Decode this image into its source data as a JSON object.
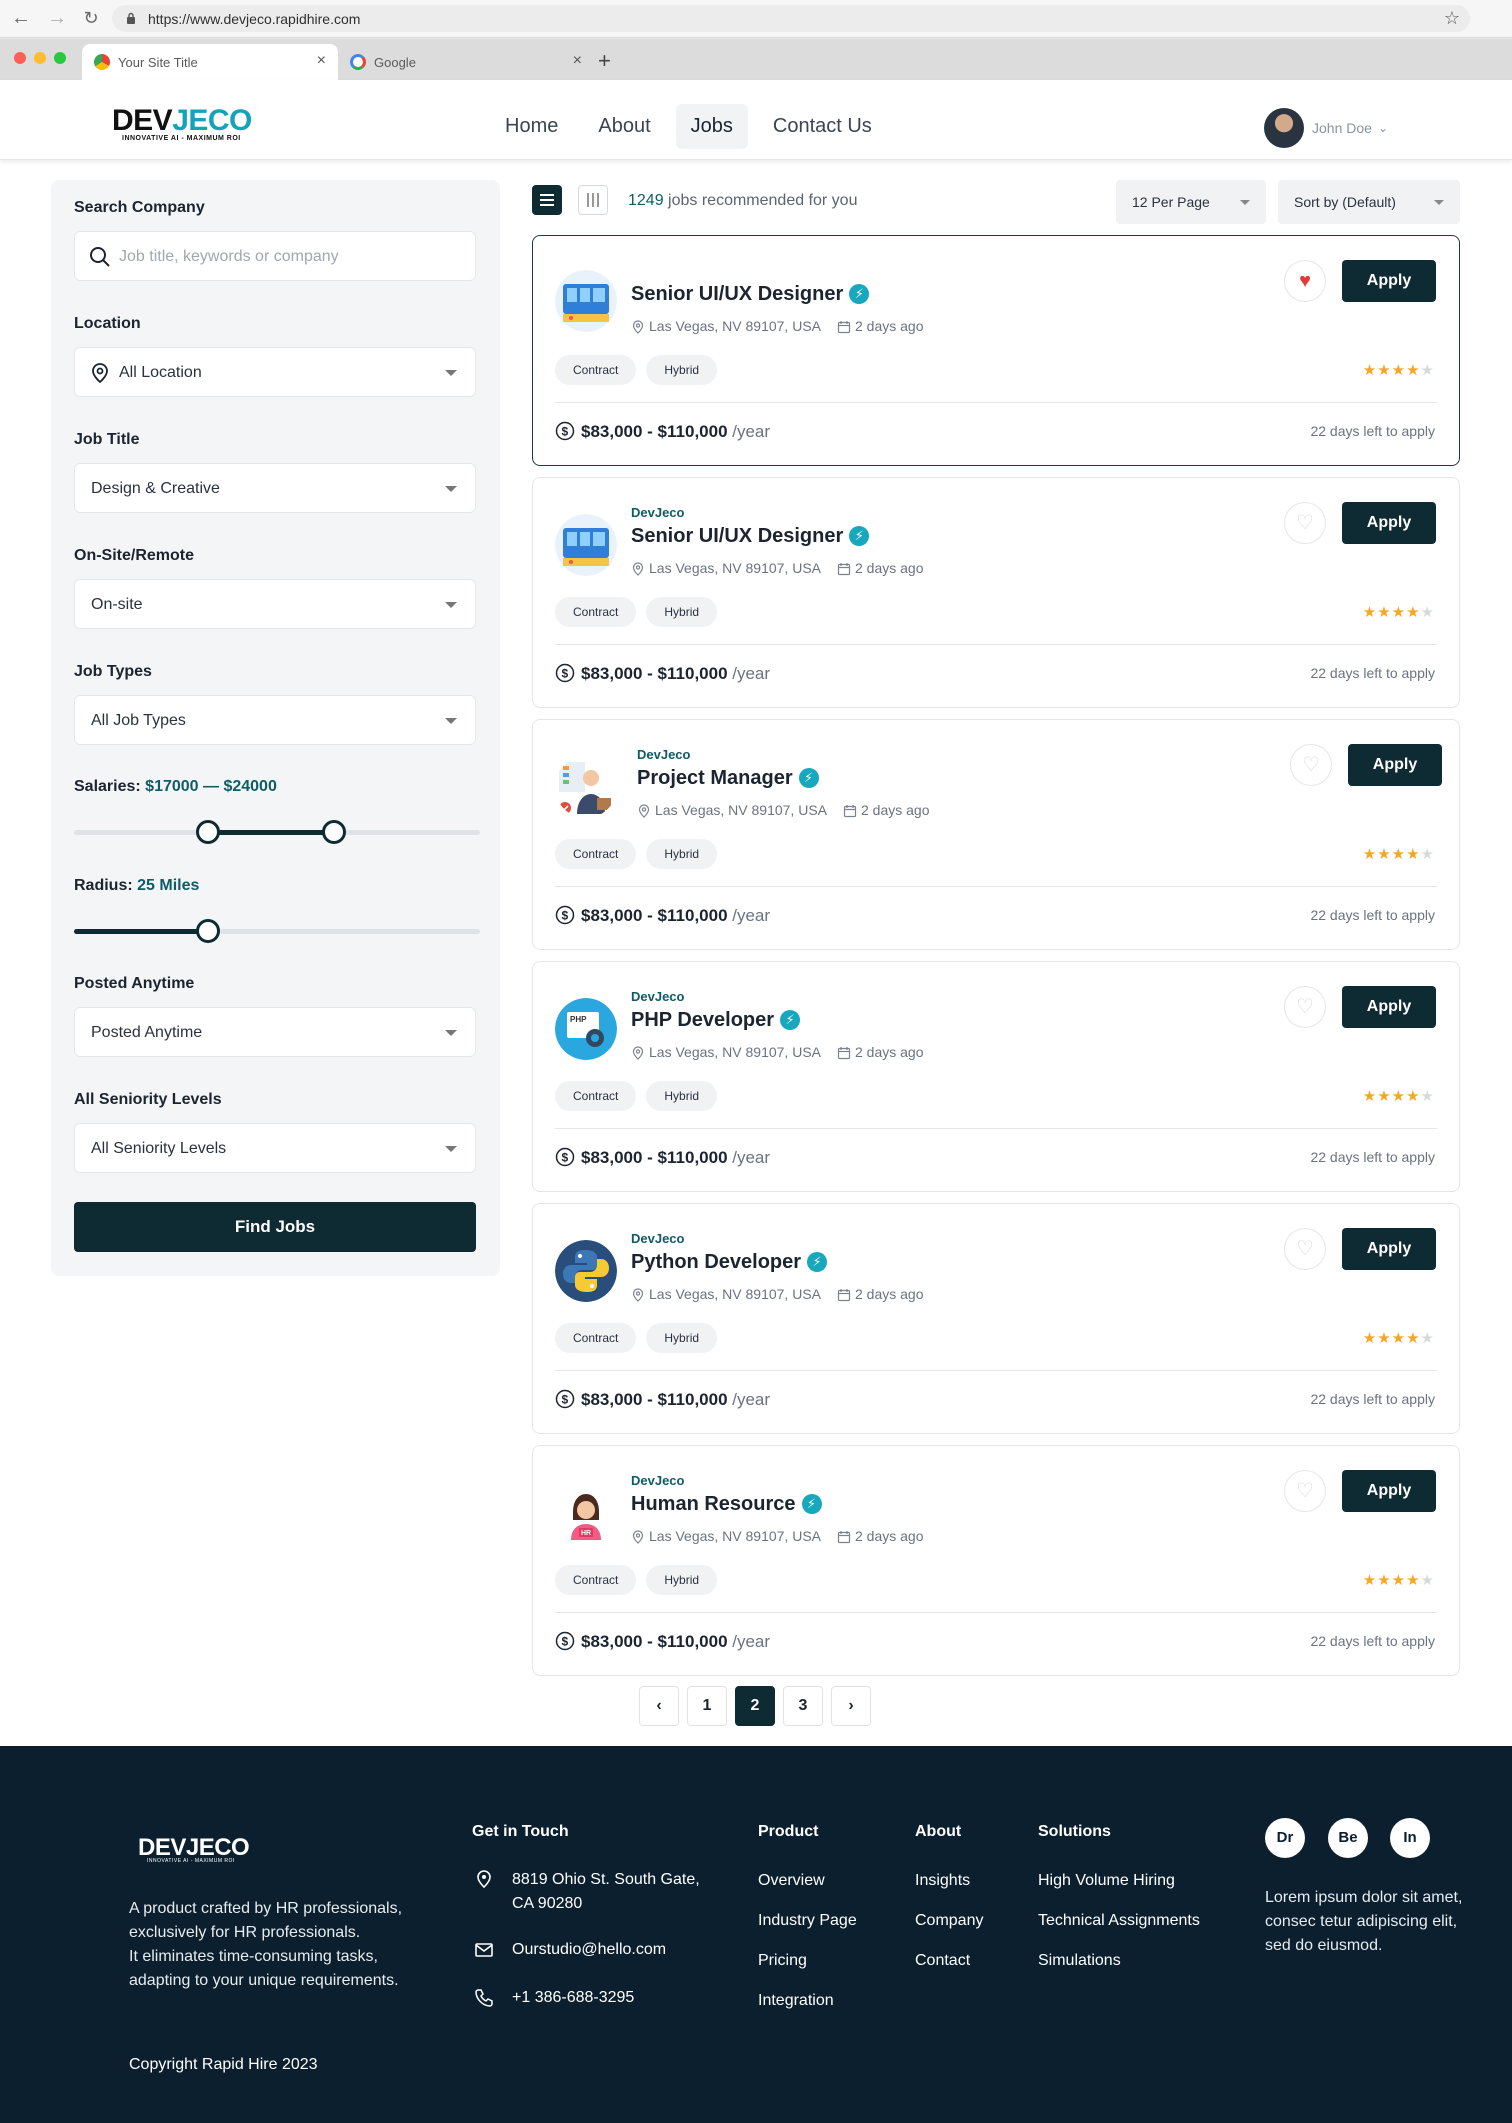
{
  "browser": {
    "url": "https://www.devjeco.rapidhire.com",
    "tabs": [
      {
        "title": "Your Site Title",
        "active": true
      },
      {
        "title": "Google",
        "active": false
      }
    ],
    "traffic_colors": [
      "#fe5f57",
      "#febc2e",
      "#28c840"
    ]
  },
  "header": {
    "logo_main_a": "DEV",
    "logo_main_b": "JECO",
    "logo_tagline": "INNOVATIVE AI - MAXIMUM ROI",
    "nav": [
      "Home",
      "About",
      "Jobs",
      "Contact Us"
    ],
    "nav_active": "Jobs",
    "user_name": "John Doe"
  },
  "sidebar": {
    "search_label": "Search Company",
    "search_placeholder": "Job title, keywords or company",
    "location_label": "Location",
    "location_value": "All Location",
    "job_title_label": "Job Title",
    "job_title_value": "Design & Creative",
    "onsite_label": "On-Site/Remote",
    "onsite_value": "On-site",
    "job_types_label": "Job Types",
    "job_types_value": "All Job Types",
    "salary_label": "Salaries:",
    "salary_range": "$17000 — $24000",
    "salary_slider": {
      "low": 0.33,
      "high": 0.64
    },
    "radius_label": "Radius:",
    "radius_value": "25 Miles",
    "radius_slider": 0.33,
    "posted_label": "Posted Anytime",
    "posted_value": "Posted Anytime",
    "seniority_label": "All Seniority Levels",
    "seniority_value": "All Seniority Levels",
    "find_button": "Find Jobs"
  },
  "results": {
    "count": "1249",
    "count_suffix": " jobs recommended for you",
    "per_page": "12 Per Page",
    "sort": "Sort by (Default)"
  },
  "jobs": [
    {
      "company": "",
      "title": "Senior UI/UX Designer",
      "location": "Las Vegas, NV 89107, USA",
      "posted": "2 days ago",
      "tags": [
        "Contract",
        "Hybrid"
      ],
      "rating": 4,
      "salary": "$83,000 - $110,000",
      "per": " /year",
      "deadline": "22 days left to apply",
      "favorited": true,
      "logo": "designer"
    },
    {
      "company": "DevJeco",
      "title": "Senior UI/UX Designer",
      "location": "Las Vegas, NV 89107, USA",
      "posted": "2 days ago",
      "tags": [
        "Contract",
        "Hybrid"
      ],
      "rating": 4,
      "salary": "$83,000 - $110,000",
      "per": " /year",
      "deadline": "22 days left to apply",
      "favorited": false,
      "logo": "designer"
    },
    {
      "company": "DevJeco",
      "title": "Project Manager",
      "location": "Las Vegas, NV 89107, USA",
      "posted": "2 days ago",
      "tags": [
        "Contract",
        "Hybrid"
      ],
      "rating": 4,
      "salary": "$83,000 - $110,000",
      "per": " /year",
      "deadline": "22 days left to apply",
      "favorited": false,
      "logo": "manager"
    },
    {
      "company": "DevJeco",
      "title": "PHP Developer",
      "location": "Las Vegas, NV 89107, USA",
      "posted": "2 days ago",
      "tags": [
        "Contract",
        "Hybrid"
      ],
      "rating": 4,
      "salary": "$83,000 - $110,000",
      "per": " /year",
      "deadline": "22 days left to apply",
      "favorited": false,
      "logo": "php"
    },
    {
      "company": "DevJeco",
      "title": "Python Developer",
      "location": "Las Vegas, NV 89107, USA",
      "posted": "2 days ago",
      "tags": [
        "Contract",
        "Hybrid"
      ],
      "rating": 4,
      "salary": "$83,000 - $110,000",
      "per": " /year",
      "deadline": "22 days left to apply",
      "favorited": false,
      "logo": "python"
    },
    {
      "company": "DevJeco",
      "title": "Human Resource",
      "location": "Las Vegas, NV 89107, USA",
      "posted": "2 days ago",
      "tags": [
        "Contract",
        "Hybrid"
      ],
      "rating": 4,
      "salary": "$83,000 - $110,000",
      "per": " /year",
      "deadline": "22 days left to apply",
      "favorited": false,
      "logo": "hr"
    }
  ],
  "pagination": {
    "pages": [
      "1",
      "2",
      "3"
    ],
    "current": "2"
  },
  "footer": {
    "logo": "DEVJECO",
    "logo_tagline": "INNOVATIVE AI - MAXIMUM ROI",
    "about_1": "A product crafted by HR professionals, exclusively for HR professionals.",
    "about_2": "It eliminates time-consuming tasks, adapting to your unique requirements.",
    "contact_head": "Get in Touch",
    "address": "8819 Ohio St. South Gate, CA 90280",
    "email": "Ourstudio@hello.com",
    "phone": "+1 386-688-3295",
    "product_head": "Product",
    "product_links": [
      "Overview",
      "Industry Page",
      "Pricing",
      "Integration"
    ],
    "about_head": "About",
    "about_links": [
      "Insights",
      "Company",
      "Contact"
    ],
    "solutions_head": "Solutions",
    "solutions_links": [
      "High Volume Hiring",
      "Technical Assignments",
      "Simulations"
    ],
    "social": [
      "Dr",
      "Be",
      "In"
    ],
    "lorem": "Lorem ipsum dolor sit amet, consec tetur adipiscing elit, sed do eiusmod.",
    "copyright": "Copyright Rapid Hire 2023"
  },
  "colors": {
    "primary": "#0e2a33",
    "accent": "#14a3b8",
    "star": "#f5a623",
    "heart": "#e53935",
    "footer": "#0b1f2e"
  }
}
